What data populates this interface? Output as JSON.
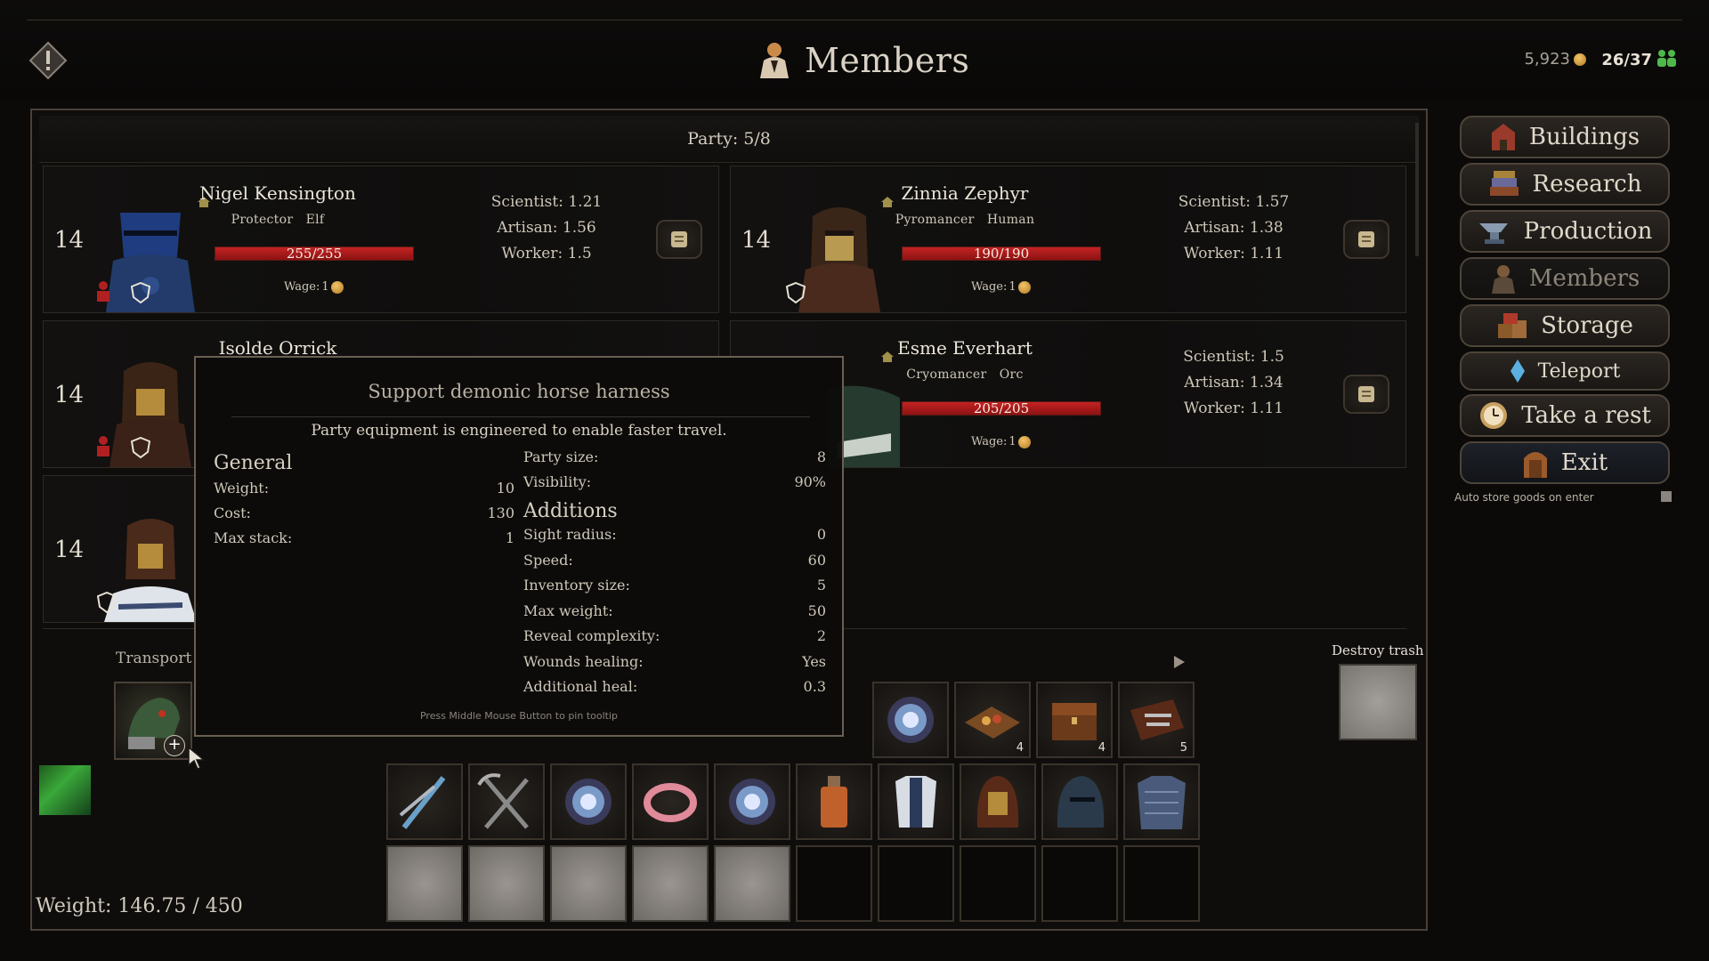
{
  "header": {
    "title": "Members",
    "gold": "5,923",
    "population": "26/37",
    "colors": {
      "accent": "#d9d2c5",
      "hp": "#c42323",
      "pop_icon": "#4fb84a",
      "coin": "#e0a84a"
    }
  },
  "party": {
    "label": "Party:",
    "value": "5/8"
  },
  "members": [
    {
      "level": "14",
      "name": "Nigel Kensington",
      "class": "Protector",
      "race": "Elf",
      "hp": "255/255",
      "hp_fraction": 1.0,
      "wage_label": "Wage:",
      "wage": "1",
      "stats": [
        "Scientist: 1.21",
        "Artisan: 1.56",
        "Worker: 1.5"
      ]
    },
    {
      "level": "14",
      "name": "Zinnia Zephyr",
      "class": "Pyromancer",
      "race": "Human",
      "hp": "190/190",
      "hp_fraction": 1.0,
      "wage_label": "Wage:",
      "wage": "1",
      "stats": [
        "Scientist: 1.57",
        "Artisan: 1.38",
        "Worker: 1.11"
      ]
    },
    {
      "level": "14",
      "name": "Isolde Orrick"
    },
    {
      "level": "14",
      "name": "Esme Everhart",
      "class": "Cryomancer",
      "race": "Orc",
      "hp": "205/205",
      "hp_fraction": 1.0,
      "wage_label": "Wage:",
      "wage": "1",
      "stats": [
        "Scientist: 1.5",
        "Artisan: 1.34",
        "Worker: 1.11"
      ]
    },
    {
      "level": "14"
    }
  ],
  "menu": [
    {
      "label": "Buildings",
      "icon": "building-icon"
    },
    {
      "label": "Research",
      "icon": "books-icon"
    },
    {
      "label": "Production",
      "icon": "anvil-icon"
    },
    {
      "label": "Members",
      "icon": "member-icon",
      "active": true
    },
    {
      "label": "Storage",
      "icon": "crates-icon"
    },
    {
      "label": "Teleport",
      "icon": "crystal-icon"
    },
    {
      "label": "Take a rest",
      "icon": "clock-icon"
    },
    {
      "label": "Exit",
      "icon": "door-icon"
    }
  ],
  "auto_store": "Auto store goods on enter",
  "inventory": {
    "transport_label": "Transport",
    "destroy_label": "Destroy trash",
    "weight": "Weight: 146.75 / 450",
    "row1": [
      {
        "icon": "orb-icon",
        "count": ""
      },
      {
        "icon": "treasure-tray-icon",
        "count": "4"
      },
      {
        "icon": "chest-icon",
        "count": "4"
      },
      {
        "icon": "tool-case-icon",
        "count": "5"
      }
    ],
    "row2": [
      {
        "icon": "daggers-icon"
      },
      {
        "icon": "pickaxes-icon"
      },
      {
        "icon": "orb-icon"
      },
      {
        "icon": "ring-icon"
      },
      {
        "icon": "orb-icon"
      },
      {
        "icon": "potion-icon"
      },
      {
        "icon": "armor-icon"
      },
      {
        "icon": "hood-icon"
      },
      {
        "icon": "helmet-icon"
      },
      {
        "icon": "chainmail-icon"
      }
    ]
  },
  "tooltip": {
    "title": "Support demonic horse harness",
    "description": "Party equipment is engineered to enable faster travel.",
    "general_heading": "General",
    "general": [
      {
        "label": "Weight:",
        "value": "10"
      },
      {
        "label": "Cost:",
        "value": "130"
      },
      {
        "label": "Max stack:",
        "value": "1"
      }
    ],
    "top_right": [
      {
        "label": "Party size:",
        "value": "8"
      },
      {
        "label": "Visibility:",
        "value": "90%"
      }
    ],
    "additions_heading": "Additions",
    "additions": [
      {
        "label": "Sight radius:",
        "value": "0"
      },
      {
        "label": "Speed:",
        "value": "60"
      },
      {
        "label": "Inventory size:",
        "value": "5"
      },
      {
        "label": "Max weight:",
        "value": "50"
      },
      {
        "label": "Reveal complexity:",
        "value": "2"
      },
      {
        "label": "Wounds healing:",
        "value": "Yes"
      },
      {
        "label": "Additional heal:",
        "value": "0.3"
      }
    ],
    "footer": "Press Middle Mouse Button to pin tooltip"
  }
}
